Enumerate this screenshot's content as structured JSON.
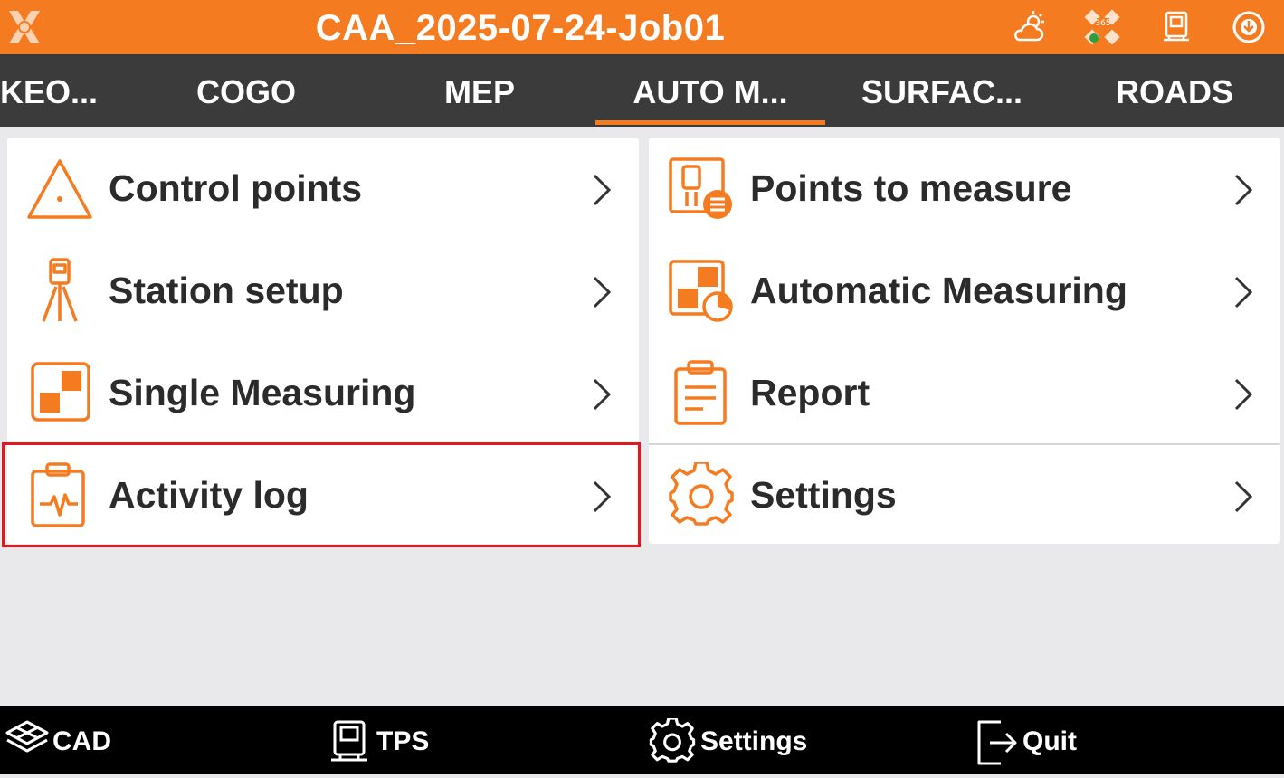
{
  "header": {
    "title": "CAA_2025-07-24-Job01",
    "icons": [
      "app-logo-icon",
      "weather-icon",
      "gnss-365-icon",
      "total-station-icon",
      "connection-icon"
    ]
  },
  "tabs": [
    {
      "label": "KEO..."
    },
    {
      "label": "COGO"
    },
    {
      "label": "MEP"
    },
    {
      "label": "AUTO M...",
      "active": true
    },
    {
      "label": "SURFAC..."
    },
    {
      "label": "ROADS"
    }
  ],
  "menu_left": [
    {
      "label": "Control points",
      "icon": "triangle-control-point-icon"
    },
    {
      "label": "Station setup",
      "icon": "tripod-station-icon"
    },
    {
      "label": "Single Measuring",
      "icon": "single-measuring-icon"
    },
    {
      "label": "Activity log",
      "icon": "clipboard-activity-icon",
      "highlighted": true
    }
  ],
  "menu_right": [
    {
      "label": "Points to measure",
      "icon": "points-list-icon"
    },
    {
      "label": "Automatic Measuring",
      "icon": "automatic-measuring-icon"
    },
    {
      "label": "Report",
      "icon": "report-clipboard-icon"
    },
    {
      "label": "Settings",
      "icon": "gear-icon"
    }
  ],
  "bottom": [
    {
      "label": "CAD",
      "icon": "layers-icon"
    },
    {
      "label": "TPS",
      "icon": "total-station-icon"
    },
    {
      "label": "Settings",
      "icon": "gear-icon"
    },
    {
      "label": "Quit",
      "icon": "exit-icon"
    }
  ],
  "colors": {
    "accent": "#f47b20",
    "tabbar": "#3b3b3b",
    "bottombar": "#000000",
    "highlight": "#e3181f"
  }
}
